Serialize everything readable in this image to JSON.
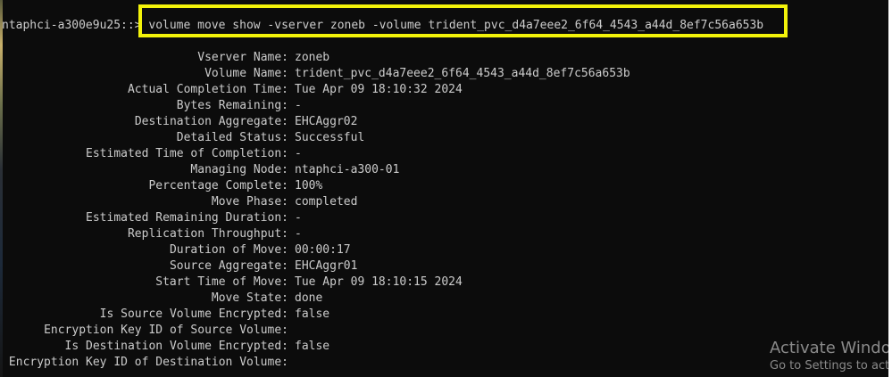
{
  "terminal": {
    "prompt": "ntaphci-a300e9u25::>",
    "command": "volume move show -vserver zoneb -volume trident_pvc_d4a7eee2_6f64_4543_a44d_8ef7c56a653b",
    "rows": [
      {
        "label": "Vserver Name:",
        "value": "zoneb"
      },
      {
        "label": "Volume Name:",
        "value": "trident_pvc_d4a7eee2_6f64_4543_a44d_8ef7c56a653b"
      },
      {
        "label": "Actual Completion Time:",
        "value": "Tue Apr 09 18:10:32 2024"
      },
      {
        "label": "Bytes Remaining:",
        "value": "-"
      },
      {
        "label": "Destination Aggregate:",
        "value": "EHCAggr02"
      },
      {
        "label": "Detailed Status:",
        "value": "Successful"
      },
      {
        "label": "Estimated Time of Completion:",
        "value": "-"
      },
      {
        "label": "Managing Node:",
        "value": "ntaphci-a300-01"
      },
      {
        "label": "Percentage Complete:",
        "value": "100%"
      },
      {
        "label": "Move Phase:",
        "value": "completed"
      },
      {
        "label": "Estimated Remaining Duration:",
        "value": "-"
      },
      {
        "label": "Replication Throughput:",
        "value": "-"
      },
      {
        "label": "Duration of Move:",
        "value": "00:00:17"
      },
      {
        "label": "Source Aggregate:",
        "value": "EHCAggr01"
      },
      {
        "label": "Start Time of Move:",
        "value": "Tue Apr 09 18:10:15 2024"
      },
      {
        "label": "Move State:",
        "value": "done"
      },
      {
        "label": "Is Source Volume Encrypted:",
        "value": "false"
      },
      {
        "label": "Encryption Key ID of Source Volume:",
        "value": ""
      },
      {
        "label": "Is Destination Volume Encrypted:",
        "value": "false"
      },
      {
        "label": "Encryption Key ID of Destination Volume:",
        "value": ""
      }
    ]
  },
  "watermark": {
    "line1": "Activate Windo",
    "line2": "Go to Settings to act"
  },
  "colors": {
    "terminal_bg": "#0c0c0c",
    "terminal_text": "#cccccc",
    "highlight_border": "#f3f30a",
    "watermark_text": "#8a8a8a"
  }
}
